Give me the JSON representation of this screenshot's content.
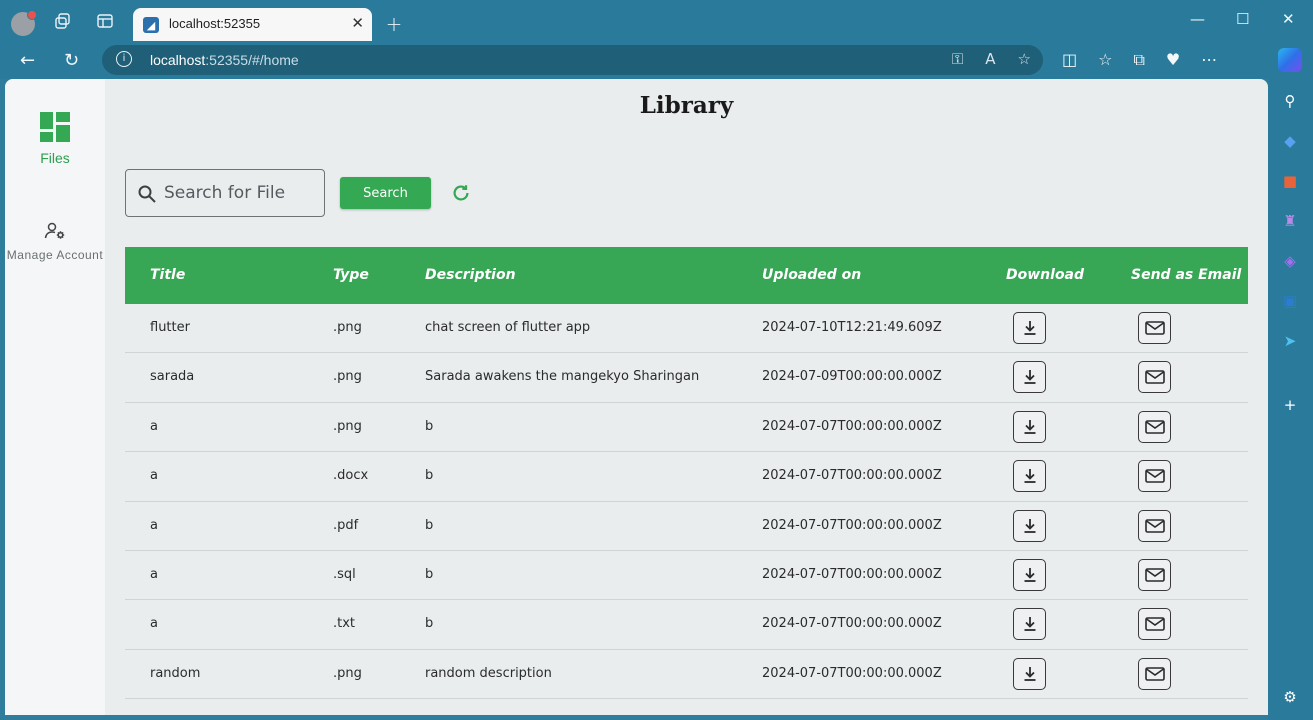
{
  "browser": {
    "tab_title": "localhost:52355",
    "url_host": "localhost",
    "url_path": ":52355/#/home"
  },
  "nav": {
    "items": [
      {
        "label": "Files",
        "icon": "dashboard-icon",
        "active": true
      },
      {
        "label": "Manage Account",
        "icon": "manage-account-icon",
        "active": false
      }
    ]
  },
  "page": {
    "title": "Library",
    "search": {
      "placeholder": "Search for File",
      "value": ""
    },
    "search_button": "Search"
  },
  "table": {
    "headers": [
      "Title",
      "Type",
      "Description",
      "Uploaded on",
      "Download",
      "Send as Email"
    ],
    "rows": [
      {
        "title": "flutter",
        "type": ".png",
        "description": "chat screen of flutter app",
        "uploaded_on": "2024-07-10T12:21:49.609Z"
      },
      {
        "title": "sarada",
        "type": ".png",
        "description": "Sarada awakens the mangekyo Sharingan",
        "uploaded_on": "2024-07-09T00:00:00.000Z"
      },
      {
        "title": "a",
        "type": ".png",
        "description": "b",
        "uploaded_on": "2024-07-07T00:00:00.000Z"
      },
      {
        "title": "a",
        "type": ".docx",
        "description": "b",
        "uploaded_on": "2024-07-07T00:00:00.000Z"
      },
      {
        "title": "a",
        "type": ".pdf",
        "description": "b",
        "uploaded_on": "2024-07-07T00:00:00.000Z"
      },
      {
        "title": "a",
        "type": ".sql",
        "description": "b",
        "uploaded_on": "2024-07-07T00:00:00.000Z"
      },
      {
        "title": "a",
        "type": ".txt",
        "description": "b",
        "uploaded_on": "2024-07-07T00:00:00.000Z"
      },
      {
        "title": "random",
        "type": ".png",
        "description": "random description",
        "uploaded_on": "2024-07-07T00:00:00.000Z"
      }
    ]
  },
  "colors": {
    "accent": "#34a853",
    "header_bg": "#37a655",
    "page_bg": "#e9edee",
    "browser_frame": "#2a7b9b"
  }
}
